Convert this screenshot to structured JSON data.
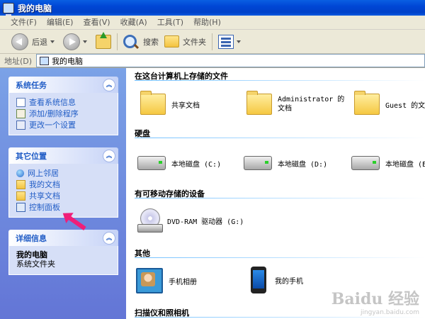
{
  "window": {
    "title": "我的电脑"
  },
  "menu": [
    "文件(F)",
    "编辑(E)",
    "查看(V)",
    "收藏(A)",
    "工具(T)",
    "帮助(H)"
  ],
  "toolbar": {
    "back_label": "后退",
    "search_label": "搜索",
    "folders_label": "文件夹"
  },
  "address": {
    "label": "地址(D)",
    "value": "我的电脑"
  },
  "sidebar": {
    "system_tasks": {
      "title": "系统任务",
      "items": [
        "查看系统信息",
        "添加/删除程序",
        "更改一个设置"
      ]
    },
    "other_places": {
      "title": "其它位置",
      "items": [
        "网上邻居",
        "我的文档",
        "共享文档",
        "控制面板"
      ]
    },
    "details": {
      "title": "详细信息",
      "name": "我的电脑",
      "type": "系统文件夹"
    }
  },
  "main": {
    "groups": [
      {
        "title": "在这台计算机上存储的文件",
        "items": [
          "共享文档",
          "Administrator 的文档",
          "Guest 的文档"
        ]
      },
      {
        "title": "硬盘",
        "items": [
          "本地磁盘 (C:)",
          "本地磁盘 (D:)",
          "本地磁盘 (E:)"
        ]
      },
      {
        "title": "有可移动存储的设备",
        "items": [
          "DVD-RAM 驱动器 (G:)"
        ]
      },
      {
        "title": "其他",
        "items": [
          "手机相册",
          "我的手机"
        ]
      },
      {
        "title": "扫描仪和照相机",
        "items": []
      }
    ]
  },
  "watermark": {
    "logo": "Baidu 经验",
    "url": "jingyan.baidu.com"
  },
  "colors": {
    "title_bar": "#0046d5",
    "sidebar_bg": "#7ba2e7",
    "task_link": "#215dc6",
    "annotation_arrow": "#f01e78"
  }
}
